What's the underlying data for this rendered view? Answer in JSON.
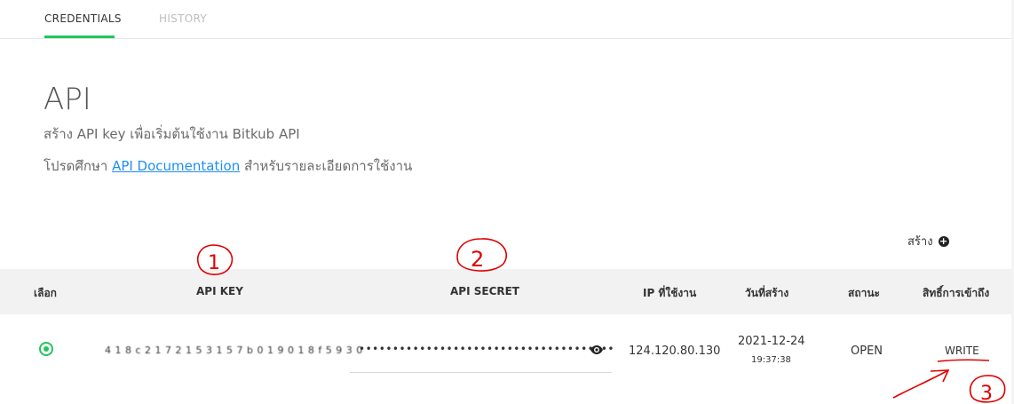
{
  "tabs": [
    {
      "label": "CREDENTIALS",
      "active": true
    },
    {
      "label": "HISTORY",
      "active": false
    }
  ],
  "header": {
    "title": "API",
    "subtitle": "สร้าง API key เพื่อเริ่มต้นใช้งาน Bitkub API",
    "doc_prefix": "โปรดศึกษา ",
    "doc_link": "API Documentation",
    "doc_suffix": " สำหรับรายละเอียดการใช้งาน"
  },
  "create": {
    "label": "สร้าง",
    "icon": "plus-circle-icon"
  },
  "table": {
    "headers": [
      "เลือก",
      "API KEY",
      "API SECRET",
      "IP ที่ใช้งาน",
      "วันที่สร้าง",
      "สถานะ",
      "สิทธิ์การเข้าถึง"
    ],
    "row": {
      "api_key": "4 1 8 c 2 1 7 2 1 5 3 1 5 7 b 0 1 9 0 1 8 f 5 9 3 0",
      "api_secret": "••••••••••••••••••••••••••••••••••••••",
      "ip": "124.120.80.130",
      "date": "2021-12-24",
      "time": "19:37:38",
      "status": "OPEN",
      "permission": "WRITE"
    }
  },
  "annotations": [
    "1",
    "2",
    "3"
  ],
  "colors": {
    "accent": "#21c55d",
    "link": "#1f8ef1",
    "annotation": "#e00000"
  }
}
